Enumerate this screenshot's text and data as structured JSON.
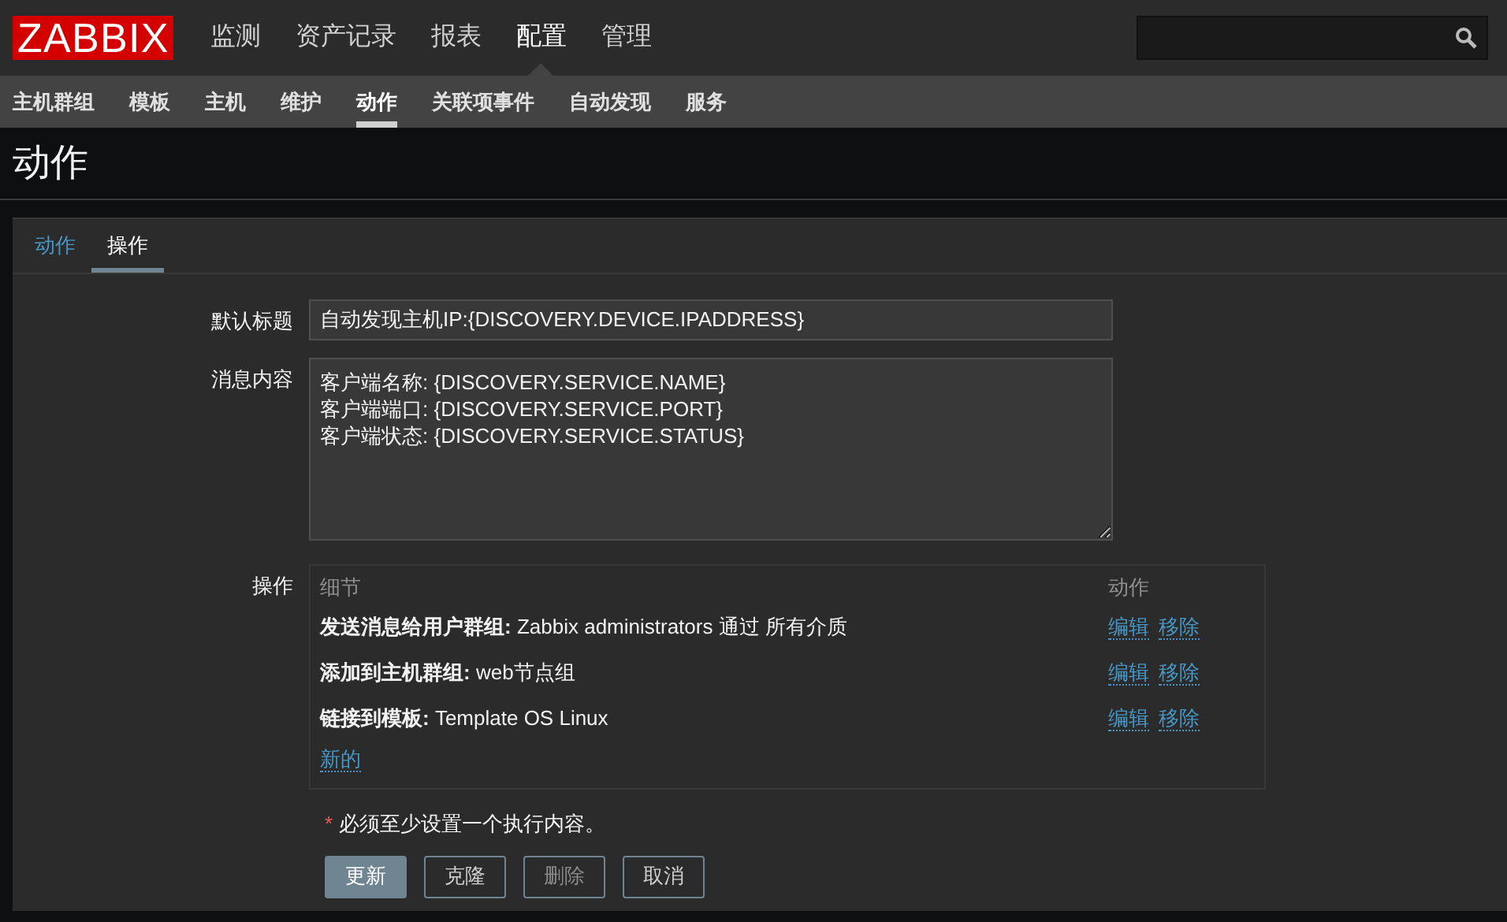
{
  "logo": "ZABBIX",
  "main_menu": [
    {
      "label": "监测",
      "selected": false
    },
    {
      "label": "资产记录",
      "selected": false
    },
    {
      "label": "报表",
      "selected": false
    },
    {
      "label": "配置",
      "selected": true
    },
    {
      "label": "管理",
      "selected": false
    }
  ],
  "sub_menu": [
    {
      "label": "主机群组",
      "selected": false
    },
    {
      "label": "模板",
      "selected": false
    },
    {
      "label": "主机",
      "selected": false
    },
    {
      "label": "维护",
      "selected": false
    },
    {
      "label": "动作",
      "selected": true
    },
    {
      "label": "关联项事件",
      "selected": false
    },
    {
      "label": "自动发现",
      "selected": false
    },
    {
      "label": "服务",
      "selected": false
    }
  ],
  "page_title": "动作",
  "tabs": [
    {
      "label": "动作",
      "selected": false
    },
    {
      "label": "操作",
      "selected": true
    }
  ],
  "form": {
    "default_subject": {
      "label": "默认标题",
      "value": "自动发现主机IP:{DISCOVERY.DEVICE.IPADDRESS}"
    },
    "message": {
      "label": "消息内容",
      "value": "客户端名称: {DISCOVERY.SERVICE.NAME}\n客户端端口: {DISCOVERY.SERVICE.PORT}\n客户端状态: {DISCOVERY.SERVICE.STATUS}"
    },
    "operations": {
      "label": "操作",
      "columns": [
        "细节",
        "动作"
      ],
      "rows": [
        {
          "detail": "**发送消息给用户群组:** Zabbix administrators 通过 所有介质",
          "actions": [
            "编辑",
            "移除"
          ]
        },
        {
          "detail": "**添加到主机群组:** web节点组",
          "actions": [
            "编辑",
            "移除"
          ]
        },
        {
          "detail": "**链接到模板:** Template OS Linux",
          "actions": [
            "编辑",
            "移除"
          ]
        }
      ],
      "new_link": "新的"
    },
    "required_mark": "*",
    "note": "必须至少设置一个执行内容。",
    "buttons": [
      {
        "label": "更新",
        "primary": true,
        "disabled": false
      },
      {
        "label": "克隆",
        "primary": false,
        "disabled": false
      },
      {
        "label": "删除",
        "primary": false,
        "disabled": true
      },
      {
        "label": "取消",
        "primary": false,
        "disabled": false
      }
    ]
  }
}
